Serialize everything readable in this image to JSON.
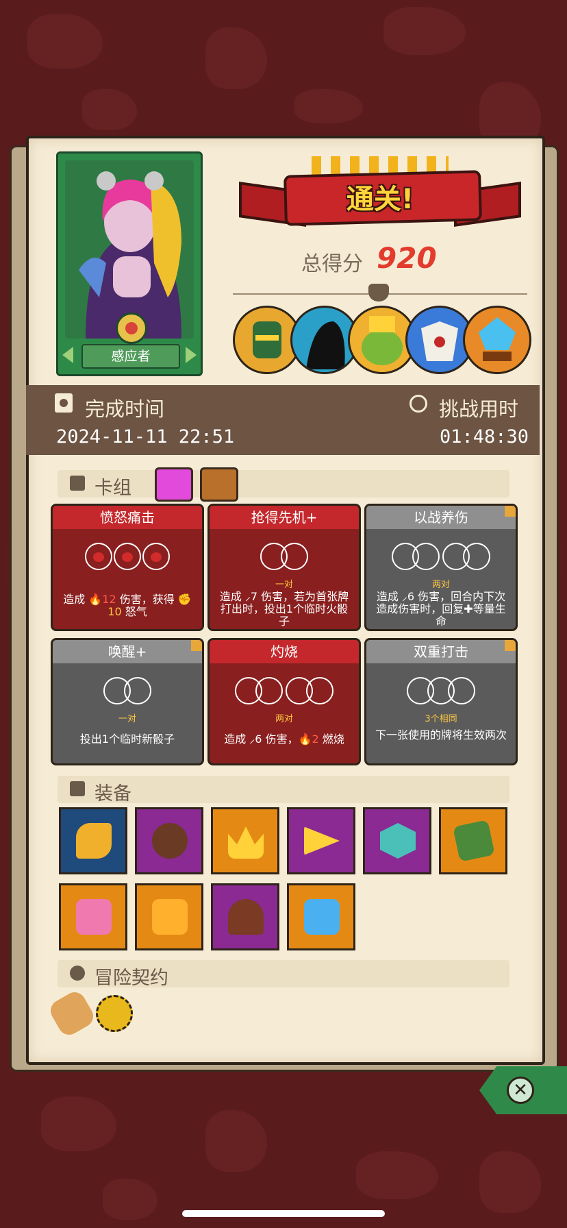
{
  "result": {
    "banner": "通关!",
    "score_label": "总得分",
    "score": "920"
  },
  "hero": {
    "name": "感应者",
    "icon": "hero-portrait"
  },
  "bosses": [
    {
      "icon": "knight-helmet-boss",
      "color": "#e8a830"
    },
    {
      "icon": "shadow-beast-boss",
      "color": "#2aa0c8"
    },
    {
      "icon": "goblin-king-boss",
      "color": "#f0b030"
    },
    {
      "icon": "skeleton-dragon-boss",
      "color": "#3a7ad8"
    },
    {
      "icon": "gem-golem-boss",
      "color": "#e88a28"
    }
  ],
  "time": {
    "finish_label": "完成时间",
    "finish_value": "2024-11-11  22:51",
    "duration_label": "挑战用时",
    "duration_value": "01:48:30"
  },
  "deck": {
    "label": "卡组",
    "cards": [
      {
        "title": "愤怒痛击",
        "style": "red",
        "req": "",
        "desc_pre": "造成 ",
        "dmg": "12",
        "desc_mid": " 伤害，获得 ",
        "extra": "10",
        "desc_post": " 怒气"
      },
      {
        "title": "抢得先机+",
        "style": "red",
        "req": "一对",
        "desc": "造成 ⸝7 伤害，若为首张牌打出时，投出1个临时火骰子"
      },
      {
        "title": "以战养伤",
        "style": "gray",
        "req": "两对",
        "desc": "造成 ⸝6 伤害，回合内下次造成伤害时，回复✚等量生命"
      },
      {
        "title": "唤醒+",
        "style": "gray",
        "req": "一对",
        "desc": "投出1个临时新骰子"
      },
      {
        "title": "灼烧",
        "style": "red",
        "req": "两对",
        "desc_pre": "造成 ⸝6 伤害，",
        "burn": "2",
        "desc_post": " 燃烧"
      },
      {
        "title": "双重打击",
        "style": "gray",
        "req": "3个相同",
        "desc": "下一张使用的牌将生效两次"
      }
    ]
  },
  "equipment": {
    "label": "装备",
    "items": [
      {
        "icon": "golden-horn-icon",
        "color": "blue"
      },
      {
        "icon": "wooden-button-icon",
        "color": "purple"
      },
      {
        "icon": "golden-crown-icon",
        "color": "orange"
      },
      {
        "icon": "cheese-wedge-icon",
        "color": "purple"
      },
      {
        "icon": "demon-mask-icon",
        "color": "purple"
      },
      {
        "icon": "green-slab-icon",
        "color": "orange"
      },
      {
        "icon": "heart-box-icon",
        "color": "orange"
      },
      {
        "icon": "fire-cube-icon",
        "color": "orange"
      },
      {
        "icon": "burning-stump-icon",
        "color": "purple"
      },
      {
        "icon": "water-die-icon",
        "color": "orange"
      }
    ]
  },
  "contracts": {
    "label": "冒险契约",
    "items": [
      {
        "icon": "scroll-contract-icon"
      },
      {
        "icon": "gold-coin-contract-icon"
      }
    ]
  },
  "close_icon": "close-icon"
}
